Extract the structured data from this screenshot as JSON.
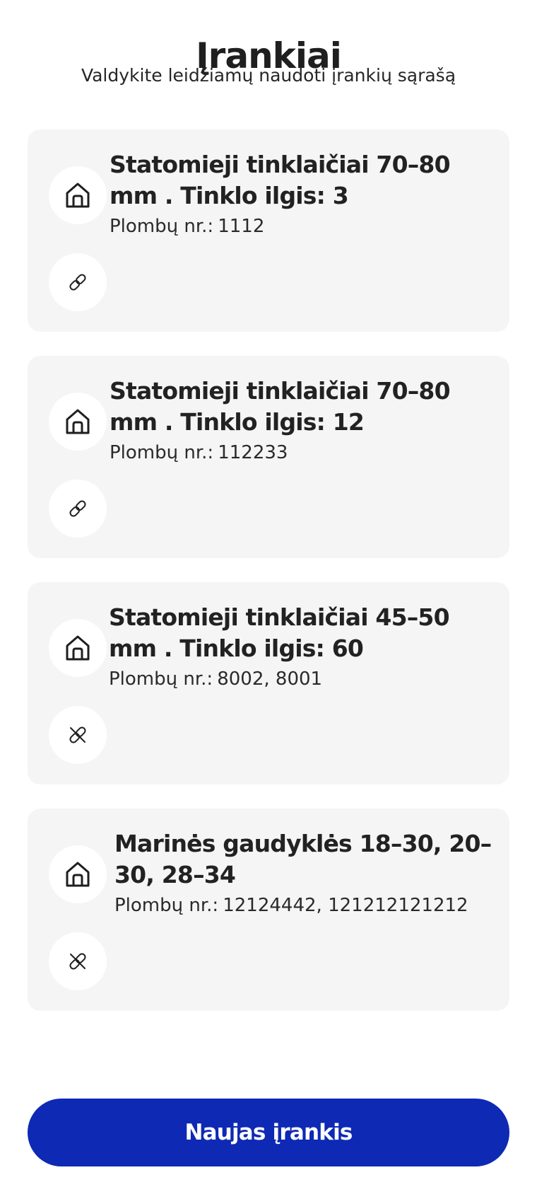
{
  "header": {
    "title": "Įrankiai",
    "subtitle": "Valdykite leidžiamų naudoti įrankių sąrašą"
  },
  "tools": [
    {
      "name": "Statomieji tinklaičiai 70–80 mm . Tinklo ilgis: 3",
      "seals_label": "Plombų nr.:",
      "seals_value": "1112",
      "location_icon": "home-icon",
      "link_icon": "link-icon"
    },
    {
      "name": "Statomieji tinklaičiai 70–80 mm . Tinklo ilgis: 12",
      "seals_label": "Plombų nr.:",
      "seals_value": "112233",
      "location_icon": "home-icon",
      "link_icon": "link-icon"
    },
    {
      "name": "Statomieji tinklaičiai 45–50 mm . Tinklo ilgis: 60",
      "seals_label": "Plombų nr.:",
      "seals_value": "8002, 8001",
      "location_icon": "home-icon",
      "link_icon": "unlink-icon"
    },
    {
      "name": "Marinės gaudyklės 18–30, 20–30, 28–34",
      "seals_label": "Plombų nr.:",
      "seals_value": "12124442, 121212121212",
      "location_icon": "home-icon",
      "link_icon": "unlink-icon"
    }
  ],
  "actions": {
    "new_tool_label": "Naujas įrankis"
  },
  "colors": {
    "primary_button": "#0e29b4",
    "card_background": "#f5f5f5",
    "text": "#1f1f1f"
  }
}
